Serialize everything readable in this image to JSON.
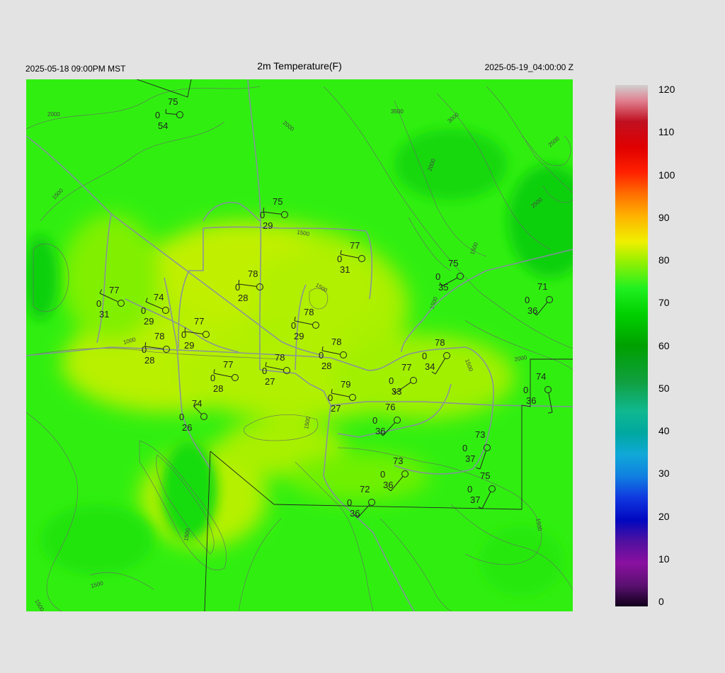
{
  "header": {
    "local_time": "2025-05-18 09:00PM MST",
    "title": "2m Temperature(F)",
    "valid_time": "2025-05-19_04:00:00 Z"
  },
  "colorbar": {
    "ticks": [
      "120",
      "110",
      "100",
      "90",
      "80",
      "70",
      "60",
      "50",
      "40",
      "30",
      "20",
      "10",
      "0"
    ]
  },
  "contour_labels": [
    "2000",
    "2000",
    "3500",
    "3000",
    "2500",
    "2500",
    "2000",
    "1500",
    "1500",
    "1500",
    "1500",
    "1000",
    "2000",
    "1500",
    "1500",
    "1500",
    "1500",
    "1500",
    "1500",
    "1500"
  ],
  "stations": [
    {
      "t": "75",
      "d": "54",
      "z": "0"
    },
    {
      "t": "75",
      "d": "29",
      "z": "0"
    },
    {
      "t": "77",
      "d": "31",
      "z": "0"
    },
    {
      "t": "75",
      "d": "35",
      "z": "0"
    },
    {
      "t": "78",
      "d": "28",
      "z": "0"
    },
    {
      "t": "77",
      "d": "31",
      "z": "0"
    },
    {
      "t": "74",
      "d": "29",
      "z": "0"
    },
    {
      "t": "71",
      "d": "36",
      "z": "0"
    },
    {
      "t": "78",
      "d": "29",
      "z": "0"
    },
    {
      "t": "77",
      "d": "29",
      "z": "0"
    },
    {
      "t": "78",
      "d": "28",
      "z": "0"
    },
    {
      "t": "78",
      "d": "28",
      "z": "0"
    },
    {
      "t": "78",
      "d": "34",
      "z": "0"
    },
    {
      "t": "78",
      "d": "27",
      "z": "0"
    },
    {
      "t": "77",
      "d": "28",
      "z": "0"
    },
    {
      "t": "77",
      "d": "33",
      "z": "0"
    },
    {
      "t": "74",
      "d": "36",
      "z": "0"
    },
    {
      "t": "79",
      "d": "27",
      "z": "0"
    },
    {
      "t": "74",
      "d": "26",
      "z": "0"
    },
    {
      "t": "76",
      "d": "36",
      "z": "0"
    },
    {
      "t": "73",
      "d": "37",
      "z": "0"
    },
    {
      "t": "73",
      "d": "36",
      "z": "0"
    },
    {
      "t": "75",
      "d": "37",
      "z": "0"
    },
    {
      "t": "72",
      "d": "36",
      "z": "0"
    }
  ]
}
